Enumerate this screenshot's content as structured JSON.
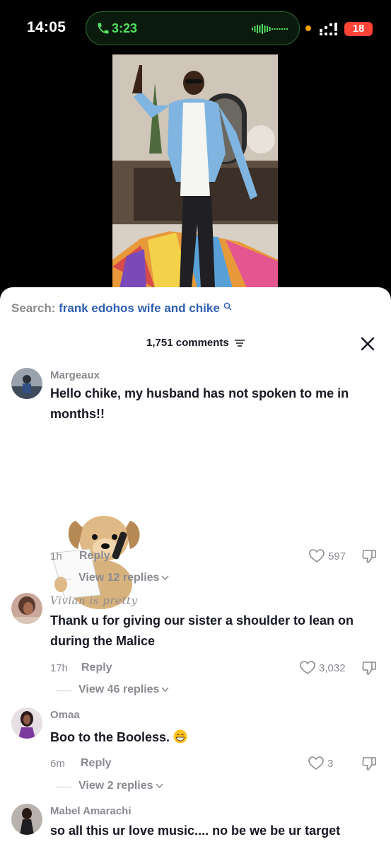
{
  "status_bar": {
    "time": "14:05",
    "call_time": "3:23",
    "battery": "18",
    "icons": [
      "phone-icon",
      "audio-wave-icon",
      "mic-indicator-dot",
      "signal-icon",
      "battery-icon"
    ]
  },
  "colors": {
    "call_green": "#52e05f",
    "battery_red": "#ff4336",
    "query_blue": "#2f5fb0",
    "muted_gray": "#8a8b91"
  },
  "search": {
    "label": "Search:",
    "query": "frank edohos wife and chike"
  },
  "comments_header": {
    "count_label": "1,751 comments"
  },
  "comments": [
    {
      "username": "Margeaux",
      "text": "Hello chike, my husband has not spoken to me in months!!",
      "time": "1h",
      "reply": "Reply",
      "likes": "597",
      "view_replies": "View 12 replies",
      "sticker": "puppy-on-phone-sticker"
    },
    {
      "username": "Vivian is pretty",
      "text": "Thank u for giving our sister a shoulder to lean on during the Malice",
      "time": "17h",
      "reply": "Reply",
      "likes": "3,032",
      "view_replies": "View 46 replies"
    },
    {
      "username": "Omaa",
      "text": "Boo to the Booless.",
      "time": "6m",
      "reply": "Reply",
      "likes": "3",
      "view_replies": "View 2 replies"
    },
    {
      "username": "Mabel Amarachi",
      "text": "so all this ur love music.... no be we be ur target"
    }
  ]
}
